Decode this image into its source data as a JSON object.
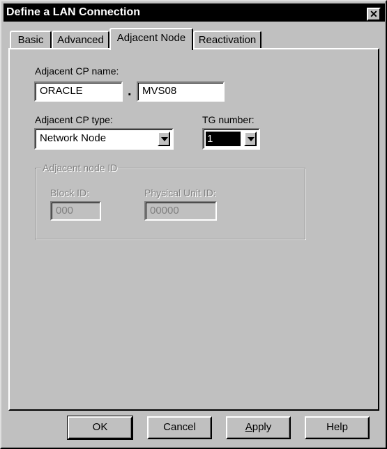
{
  "window": {
    "title": "Define a LAN Connection",
    "close_glyph": "✕"
  },
  "tabs": [
    {
      "label": "Basic"
    },
    {
      "label": "Advanced"
    },
    {
      "label": "Adjacent Node",
      "selected": true
    },
    {
      "label": "Reactivation"
    }
  ],
  "form": {
    "cp_name_label": "Adjacent CP name:",
    "cp_name_network": "ORACLE",
    "separator": ".",
    "cp_name_cp": "MVS08",
    "cp_type_label": "Adjacent CP type:",
    "cp_type_value": "Network Node",
    "tg_label": "TG number:",
    "tg_value": "1",
    "group_label": "Adjacent node ID",
    "block_id_label": "Block ID:",
    "block_id_value": "000",
    "pu_id_label": "Physical Unit ID:",
    "pu_id_value": "00000"
  },
  "buttons": {
    "ok": "OK",
    "cancel": "Cancel",
    "apply": "Apply",
    "help": "Help"
  }
}
